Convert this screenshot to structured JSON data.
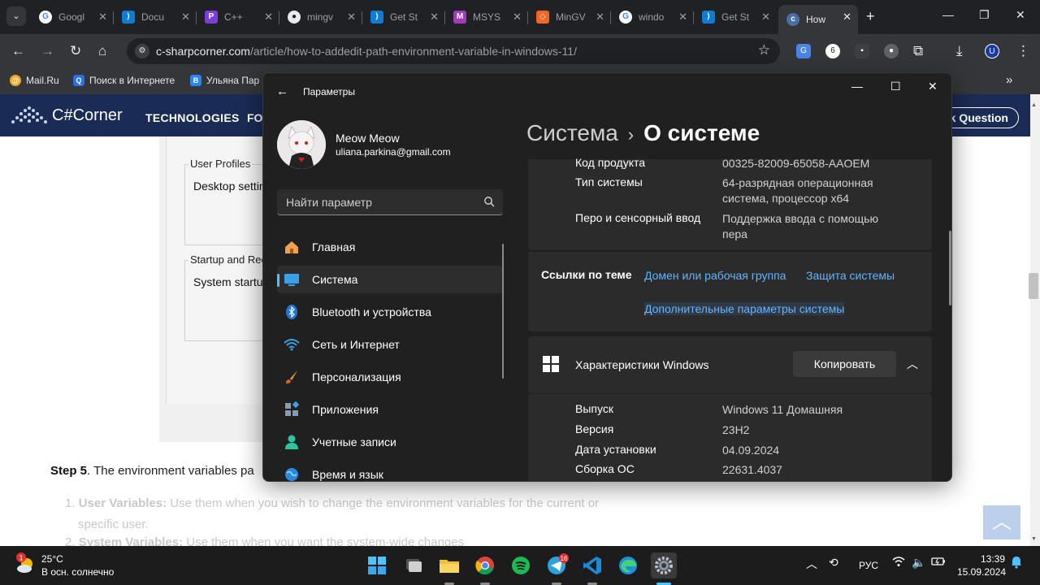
{
  "browser": {
    "tabs": [
      {
        "label": "Googl",
        "icon": "google-icon"
      },
      {
        "label": "Docu",
        "icon": "vscode-icon"
      },
      {
        "label": "C++",
        "icon": "cpp-icon"
      },
      {
        "label": "mingv",
        "icon": "github-icon"
      },
      {
        "label": "Get St",
        "icon": "vscode-icon"
      },
      {
        "label": "MSYS",
        "icon": "msys-icon"
      },
      {
        "label": "MinGV",
        "icon": "sourceforge-icon"
      },
      {
        "label": "windo",
        "icon": "google-icon"
      },
      {
        "label": "Get St",
        "icon": "vscode-icon"
      },
      {
        "label": "How",
        "icon": "csharpcorner-icon"
      }
    ],
    "url_host": "c-sharpcorner.com",
    "url_path": "/article/how-to-addedit-path-environment-variable-in-windows-11/",
    "bookmarks": [
      "Mail.Ru",
      "Поиск в Интернете",
      "Ульяна Пар"
    ]
  },
  "page": {
    "logo_text": "C#Corner",
    "nav_technologies": "TECHNOLOGIES",
    "nav_fo": "FO",
    "ask_question": "k Question",
    "group1_title": "User Profiles",
    "group1_body": "Desktop setting",
    "group2_title": "Startup and Rec",
    "group2_body": "System startup,",
    "step_label": "Step 5",
    "step_text": ". The environment variables pa",
    "list": [
      {
        "num": "1.",
        "bold": "User Variables:",
        "text": " Use them when you wish to change the environment variables for the current or"
      },
      {
        "num": "",
        "bold": "",
        "text": "specific user."
      },
      {
        "num": "2.",
        "bold": "System Variables:",
        "text": " Use them when you want the system-wide changes"
      }
    ]
  },
  "settings": {
    "window_title": "Параметры",
    "user_name": "Meow Meow",
    "user_email": "uliana.parkina@gmail.com",
    "search_placeholder": "Найти параметр",
    "nav": [
      {
        "label": "Главная",
        "icon": "home-icon"
      },
      {
        "label": "Система",
        "icon": "system-icon",
        "selected": true
      },
      {
        "label": "Bluetooth и устройства",
        "icon": "bluetooth-icon"
      },
      {
        "label": "Сеть и Интернет",
        "icon": "wifi-icon"
      },
      {
        "label": "Персонализация",
        "icon": "brush-icon"
      },
      {
        "label": "Приложения",
        "icon": "apps-icon"
      },
      {
        "label": "Учетные записи",
        "icon": "account-icon"
      },
      {
        "label": "Время и язык",
        "icon": "globe-icon"
      }
    ],
    "breadcrumb_parent": "Система",
    "breadcrumb_sep": "›",
    "breadcrumb_current": "О системе",
    "device_specs": [
      {
        "key": "Код продукта",
        "value": "00325-82009-65058-AAOEM"
      },
      {
        "key": "Тип системы",
        "value": "64-разрядная операционная система, процессор x64"
      },
      {
        "key": "Перо и сенсорный ввод",
        "value": "Поддержка ввода с помощью пера"
      }
    ],
    "related_label": "Ссылки по теме",
    "related_links": [
      "Домен или рабочая группа",
      "Защита системы",
      "Дополнительные параметры системы"
    ],
    "windows_specs_title": "Характеристики Windows",
    "copy_button": "Копировать",
    "windows_specs": [
      {
        "key": "Выпуск",
        "value": "Windows 11 Домашняя"
      },
      {
        "key": "Версия",
        "value": "23H2"
      },
      {
        "key": "Дата установки",
        "value": "04.09.2024"
      },
      {
        "key": "Сборка ОС",
        "value": "22631.4037"
      }
    ]
  },
  "taskbar": {
    "weather_temp": "25°C",
    "weather_desc": "В осн. солнечно",
    "weather_badge": "1",
    "telegram_badge": "16",
    "lang": "РУС",
    "time": "13:39",
    "date": "15.09.2024"
  }
}
